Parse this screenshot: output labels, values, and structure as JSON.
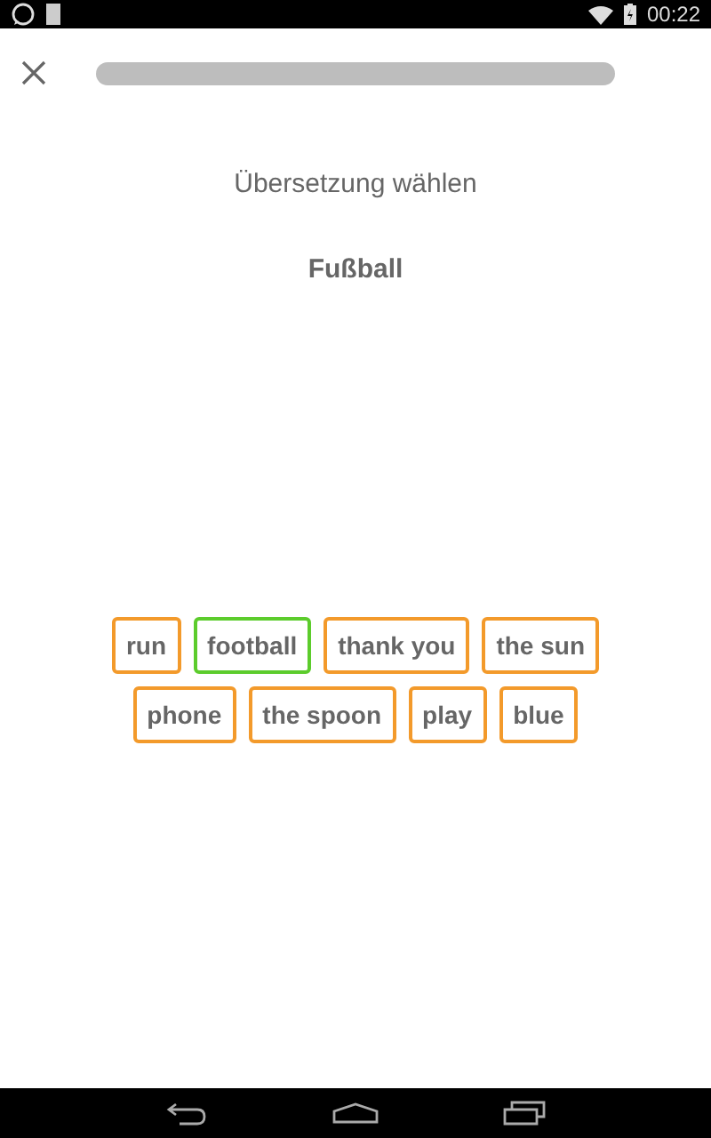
{
  "status_bar": {
    "time": "00:22"
  },
  "progress": {
    "level": 0
  },
  "prompt": "Übersetzung wählen",
  "word": "Fußball",
  "choices": [
    {
      "label": "run",
      "selected": false
    },
    {
      "label": "football",
      "selected": true
    },
    {
      "label": "thank you",
      "selected": false
    },
    {
      "label": "the sun",
      "selected": false
    },
    {
      "label": "phone",
      "selected": false
    },
    {
      "label": "the spoon",
      "selected": false
    },
    {
      "label": "play",
      "selected": false
    },
    {
      "label": "blue",
      "selected": false
    }
  ]
}
